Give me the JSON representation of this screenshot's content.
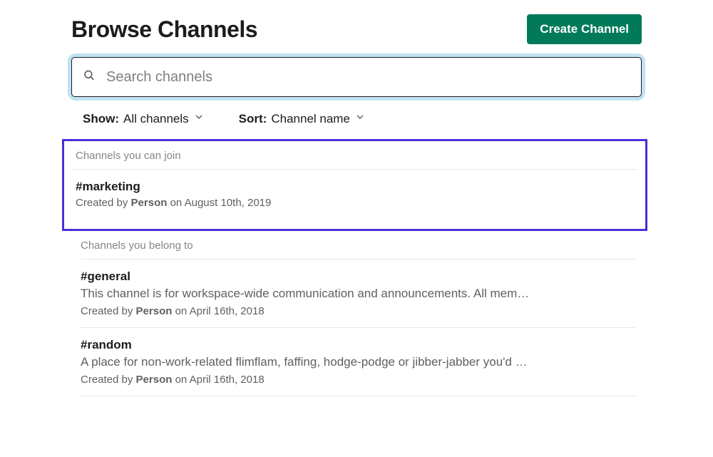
{
  "header": {
    "title": "Browse Channels",
    "create_label": "Create Channel"
  },
  "search": {
    "placeholder": "Search channels"
  },
  "filters": {
    "show_label": "Show:",
    "show_value": "All channels",
    "sort_label": "Sort:",
    "sort_value": "Channel name"
  },
  "sections": {
    "joinable": {
      "label": "Channels you can join",
      "items": [
        {
          "name": "#marketing",
          "created_prefix": "Created by ",
          "created_person": "Person",
          "created_suffix": " on August 10th, 2019"
        }
      ]
    },
    "belong": {
      "label": "Channels you belong to",
      "items": [
        {
          "name": "#general",
          "desc": "This channel is for workspace-wide communication and announcements. All mem…",
          "created_prefix": "Created by ",
          "created_person": "Person",
          "created_suffix": " on April 16th, 2018"
        },
        {
          "name": "#random",
          "desc": "A place for non-work-related flimflam, faffing, hodge-podge or jibber-jabber you'd …",
          "created_prefix": "Created by ",
          "created_person": "Person",
          "created_suffix": " on April 16th, 2018"
        }
      ]
    }
  }
}
